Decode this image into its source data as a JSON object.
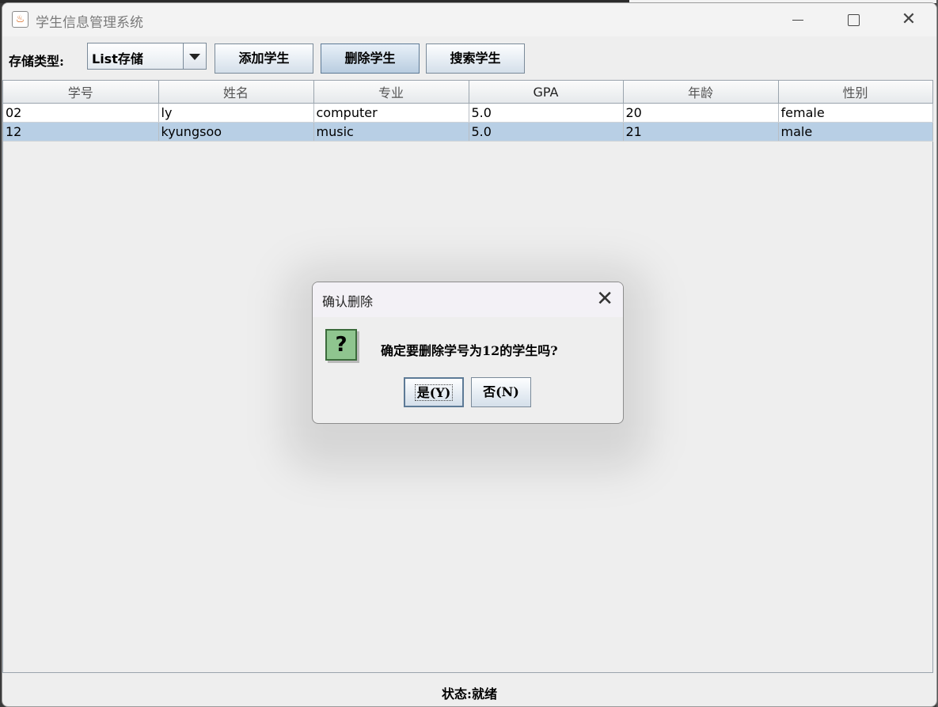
{
  "window": {
    "title": "学生信息管理系统",
    "controls": {
      "minimize": "—",
      "maximize": "□",
      "close": "✕"
    }
  },
  "toolbar": {
    "storage_label": "存储类型:",
    "storage_selected": "List存储",
    "add_label": "添加学生",
    "delete_label": "删除学生",
    "search_label": "搜索学生"
  },
  "table": {
    "columns": [
      "学号",
      "姓名",
      "专业",
      "GPA",
      "年龄",
      "性别"
    ],
    "rows": [
      [
        "02",
        "ly",
        "computer",
        "5.0",
        "20",
        "female"
      ],
      [
        "12",
        "kyungsoo",
        "music",
        "5.0",
        "21",
        "male"
      ]
    ],
    "selected_row": 1
  },
  "status": {
    "text": "状态:就绪"
  },
  "dialog": {
    "title": "确认删除",
    "icon": "question-icon",
    "icon_glyph": "?",
    "message": "确定要删除学号为12的学生吗?",
    "yes_label": "是(Y)",
    "no_label": "否(N)",
    "close_glyph": "✕"
  }
}
